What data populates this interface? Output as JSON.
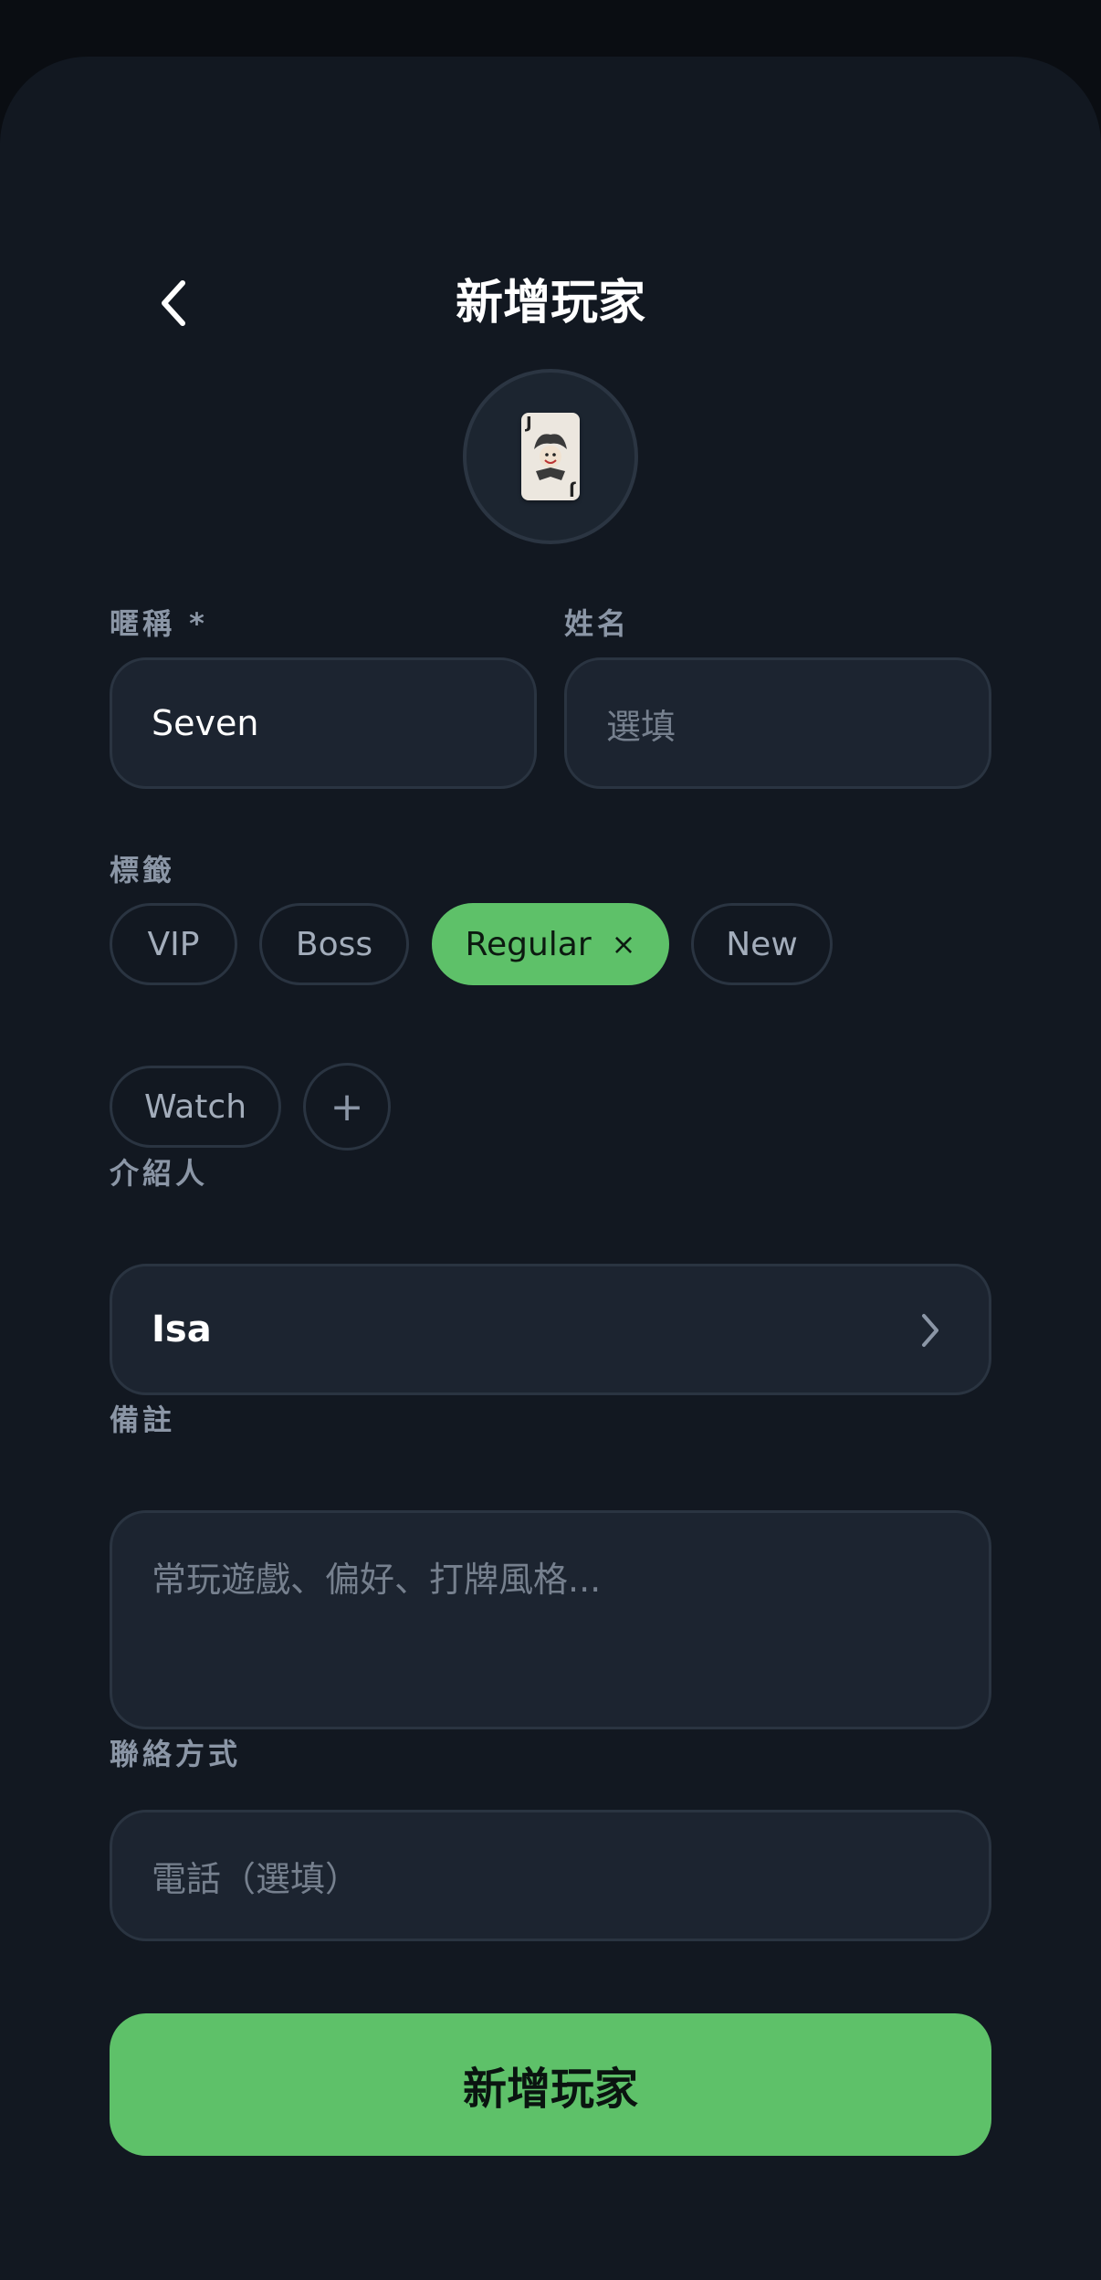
{
  "header": {
    "title": "新增玩家"
  },
  "avatar": {
    "emoji_name": "joker-card",
    "rank": "J"
  },
  "form": {
    "nickname": {
      "label": "暱稱 *",
      "value": "Seven"
    },
    "name": {
      "label": "姓名",
      "placeholder": "選填"
    },
    "tags": {
      "label": "標籤",
      "items": [
        {
          "label": "VIP",
          "selected": false
        },
        {
          "label": "Boss",
          "selected": false
        },
        {
          "label": "Regular",
          "selected": true
        },
        {
          "label": "New",
          "selected": false
        },
        {
          "label": "Watch",
          "selected": false
        }
      ],
      "remove_symbol": "×",
      "add_symbol": "+"
    },
    "referrer": {
      "label": "介紹人",
      "value": "Isa"
    },
    "notes": {
      "label": "備註",
      "placeholder": "常玩遊戲、偏好、打牌風格..."
    },
    "contact": {
      "label": "聯絡方式",
      "phone_placeholder": "電話（選填）"
    }
  },
  "submit": {
    "label": "新增玩家"
  },
  "colors": {
    "background": "#121821",
    "field": "#1c2430",
    "accent": "#5ec169",
    "label": "#8b96a6"
  }
}
